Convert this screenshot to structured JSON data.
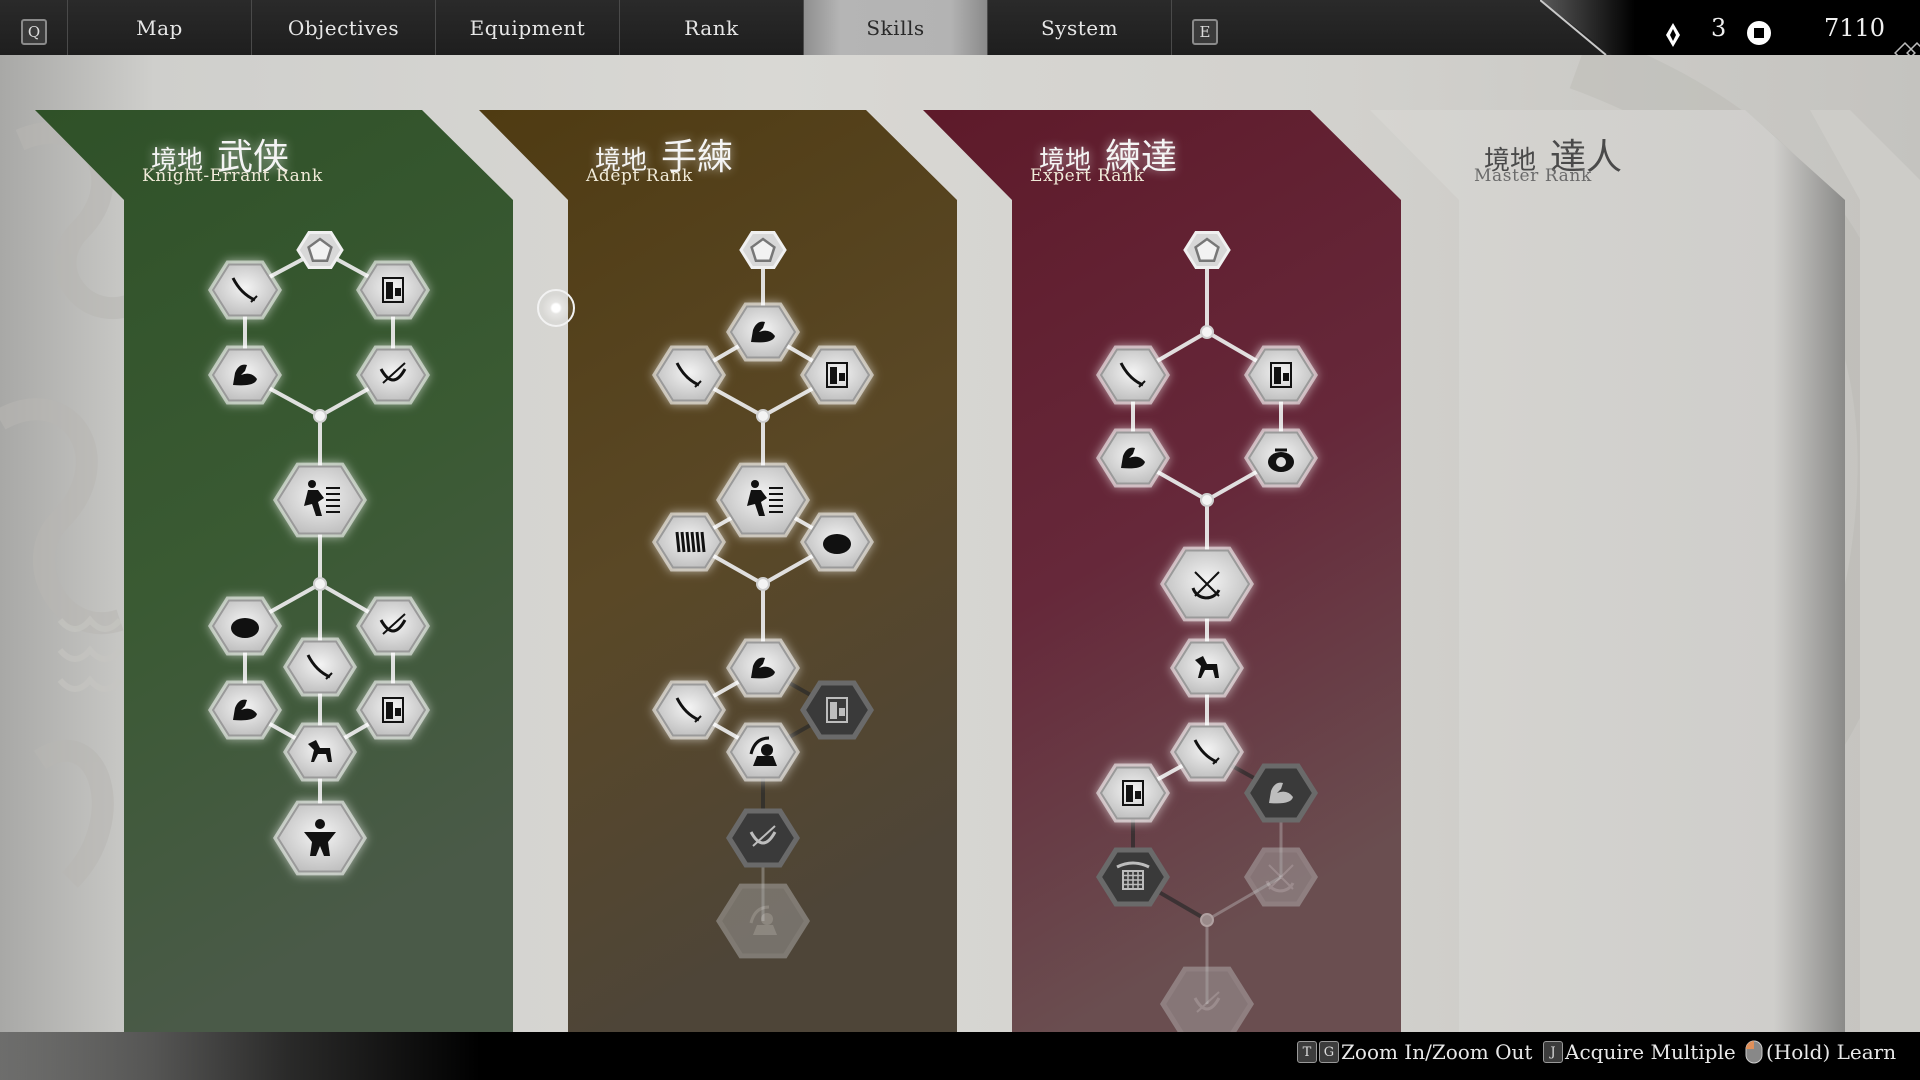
{
  "top_nav": {
    "prev_key": "Q",
    "next_key": "E",
    "tabs": [
      {
        "label": "Map",
        "active": false
      },
      {
        "label": "Objectives",
        "active": false
      },
      {
        "label": "Equipment",
        "active": false
      },
      {
        "label": "Rank",
        "active": false
      },
      {
        "label": "Skills",
        "active": true
      },
      {
        "label": "System",
        "active": false
      }
    ]
  },
  "currency": {
    "skill_points_icon": "diamond-icon",
    "skill_points": "3",
    "coins_icon": "coin-icon",
    "coins": "7110"
  },
  "ranks": [
    {
      "kanji_prefix": "境地",
      "kanji": "武侠",
      "name": "Knight-Errant Rank",
      "color": "#3a5a32",
      "state": "unlocked"
    },
    {
      "kanji_prefix": "境地",
      "kanji": "手練",
      "name": "Adept Rank",
      "color": "#5a4520",
      "state": "unlocked"
    },
    {
      "kanji_prefix": "境地",
      "kanji": "練達",
      "name": "Expert Rank",
      "color": "#6a2030",
      "state": "unlocked"
    },
    {
      "kanji_prefix": "境地",
      "kanji": "達人",
      "name": "Master Rank",
      "color": "#d0d0cc",
      "state": "locked"
    }
  ],
  "skill_trees": [
    {
      "rank": "Knight-Errant Rank",
      "nodes": [
        {
          "icon": "pentagon-start-icon",
          "state": "acquired"
        },
        {
          "icon": "sword-icon",
          "state": "acquired"
        },
        {
          "icon": "book-icon",
          "state": "acquired"
        },
        {
          "icon": "arm-strength-icon",
          "state": "acquired"
        },
        {
          "icon": "bow-icon",
          "state": "acquired"
        },
        {
          "icon": "dash-kick-icon",
          "state": "acquired",
          "major": true
        },
        {
          "icon": "bun-food-icon",
          "state": "acquired"
        },
        {
          "icon": "bow-icon",
          "state": "acquired"
        },
        {
          "icon": "sword-icon",
          "state": "acquired"
        },
        {
          "icon": "arm-strength-icon",
          "state": "acquired"
        },
        {
          "icon": "book-icon",
          "state": "acquired"
        },
        {
          "icon": "horse-icon",
          "state": "acquired"
        },
        {
          "icon": "warrior-power-icon",
          "state": "acquired",
          "major": true
        }
      ]
    },
    {
      "rank": "Adept Rank",
      "nodes": [
        {
          "icon": "pentagon-start-icon",
          "state": "acquired"
        },
        {
          "icon": "arm-strength-icon",
          "state": "acquired"
        },
        {
          "icon": "sword-icon",
          "state": "acquired"
        },
        {
          "icon": "book-icon",
          "state": "acquired"
        },
        {
          "icon": "dash-kick-icon",
          "state": "acquired",
          "major": true
        },
        {
          "icon": "abacus-icon",
          "state": "acquired"
        },
        {
          "icon": "bun-food-icon",
          "state": "acquired"
        },
        {
          "icon": "arm-strength-icon",
          "state": "acquired"
        },
        {
          "icon": "sword-icon",
          "state": "acquired"
        },
        {
          "icon": "book-icon",
          "state": "available"
        },
        {
          "icon": "sword-strike-icon",
          "state": "acquired"
        },
        {
          "icon": "bow-icon",
          "state": "available"
        },
        {
          "icon": "sword-strike-icon",
          "state": "locked",
          "major": true
        }
      ]
    },
    {
      "rank": "Expert Rank",
      "nodes": [
        {
          "icon": "pentagon-start-icon",
          "state": "acquired"
        },
        {
          "icon": "sword-icon",
          "state": "acquired"
        },
        {
          "icon": "book-icon",
          "state": "acquired"
        },
        {
          "icon": "arm-strength-icon",
          "state": "acquired"
        },
        {
          "icon": "money-bag-icon",
          "state": "acquired"
        },
        {
          "icon": "crossed-bow-icon",
          "state": "acquired",
          "major": true
        },
        {
          "icon": "horse-icon",
          "state": "acquired"
        },
        {
          "icon": "sword-icon",
          "state": "acquired"
        },
        {
          "icon": "book-icon",
          "state": "acquired"
        },
        {
          "icon": "arm-strength-icon",
          "state": "available"
        },
        {
          "icon": "armor-icon",
          "state": "available"
        },
        {
          "icon": "crossed-bow-icon",
          "state": "locked"
        },
        {
          "icon": "bow-icon",
          "state": "locked",
          "major": true
        }
      ]
    }
  ],
  "hints": [
    {
      "keys": [
        "T",
        "G"
      ],
      "label": "Zoom In/Zoom Out"
    },
    {
      "keys": [
        "J"
      ],
      "label": "Acquire Multiple"
    },
    {
      "keys": [
        "mouse-left-icon"
      ],
      "label": "(Hold) Learn"
    }
  ]
}
